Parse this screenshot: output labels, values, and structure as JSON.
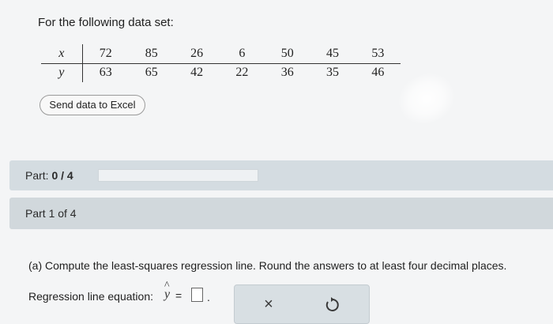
{
  "intro_text": "For the following data set:",
  "table": {
    "x_label": "x",
    "y_label": "y",
    "x_values": [
      "72",
      "85",
      "26",
      "6",
      "50",
      "45",
      "53"
    ],
    "y_values": [
      "63",
      "65",
      "42",
      "22",
      "36",
      "35",
      "46"
    ]
  },
  "send_button_label": "Send data to Excel",
  "part_progress": {
    "label": "Part:",
    "value": "0 / 4",
    "fraction": 0
  },
  "part_header": "Part 1 of 4",
  "question": "(a) Compute the least-squares regression line. Round the answers to at least four decimal places.",
  "answer": {
    "label": "Regression line equation:",
    "symbol": "y",
    "hat": "^",
    "equals": "=",
    "value": "",
    "period": "."
  },
  "actions": {
    "clear_icon": "×"
  },
  "colors": {
    "accent": "#6aa0c8",
    "part_bar": "#d4dce1"
  }
}
